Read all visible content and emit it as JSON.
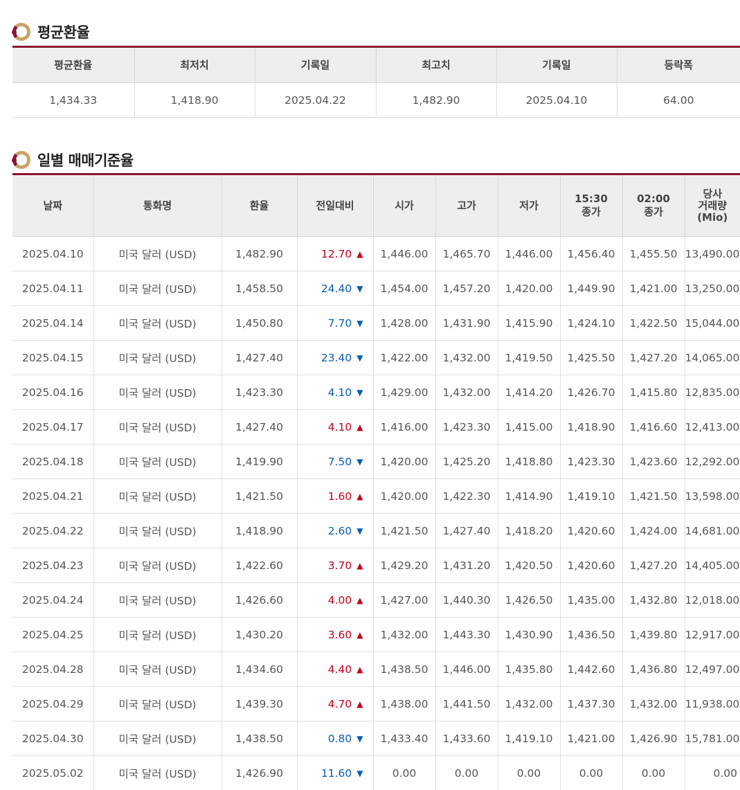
{
  "avg_section": {
    "title": "평균환율",
    "headers": [
      "평균환율",
      "최저치",
      "기록일",
      "최고치",
      "기록일",
      "등락폭"
    ],
    "values": [
      "1,434.33",
      "1,418.90",
      "2025.04.22",
      "1,482.90",
      "2025.04.10",
      "64.00"
    ]
  },
  "daily_section": {
    "title": "일별 매매기준율",
    "headers": [
      "날짜",
      "통화명",
      "환율",
      "전일대비",
      "시가",
      "고가",
      "저가",
      "15:30\n종가",
      "02:00\n종가",
      "당사\n거래량\n(Mio)"
    ],
    "rows": [
      {
        "date": "2025.04.10",
        "currency": "미국 달러 (USD)",
        "rate": "1,482.90",
        "change": "12.70",
        "dir": "up",
        "open": "1,446.00",
        "high": "1,465.70",
        "low": "1,446.00",
        "close1530": "1,456.40",
        "close0200": "1,455.50",
        "volume": "13,490.00"
      },
      {
        "date": "2025.04.11",
        "currency": "미국 달러 (USD)",
        "rate": "1,458.50",
        "change": "24.40",
        "dir": "down",
        "open": "1,454.00",
        "high": "1,457.20",
        "low": "1,420.00",
        "close1530": "1,449.90",
        "close0200": "1,421.00",
        "volume": "13,250.00"
      },
      {
        "date": "2025.04.14",
        "currency": "미국 달러 (USD)",
        "rate": "1,450.80",
        "change": "7.70",
        "dir": "down",
        "open": "1,428.00",
        "high": "1,431.90",
        "low": "1,415.90",
        "close1530": "1,424.10",
        "close0200": "1,422.50",
        "volume": "15,044.00"
      },
      {
        "date": "2025.04.15",
        "currency": "미국 달러 (USD)",
        "rate": "1,427.40",
        "change": "23.40",
        "dir": "down",
        "open": "1,422.00",
        "high": "1,432.00",
        "low": "1,419.50",
        "close1530": "1,425.50",
        "close0200": "1,427.20",
        "volume": "14,065.00"
      },
      {
        "date": "2025.04.16",
        "currency": "미국 달러 (USD)",
        "rate": "1,423.30",
        "change": "4.10",
        "dir": "down",
        "open": "1,429.00",
        "high": "1,432.00",
        "low": "1,414.20",
        "close1530": "1,426.70",
        "close0200": "1,415.80",
        "volume": "12,835.00"
      },
      {
        "date": "2025.04.17",
        "currency": "미국 달러 (USD)",
        "rate": "1,427.40",
        "change": "4.10",
        "dir": "up",
        "open": "1,416.00",
        "high": "1,423.30",
        "low": "1,415.00",
        "close1530": "1,418.90",
        "close0200": "1,416.60",
        "volume": "12,413.00"
      },
      {
        "date": "2025.04.18",
        "currency": "미국 달러 (USD)",
        "rate": "1,419.90",
        "change": "7.50",
        "dir": "down",
        "open": "1,420.00",
        "high": "1,425.20",
        "low": "1,418.80",
        "close1530": "1,423.30",
        "close0200": "1,423.60",
        "volume": "12,292.00"
      },
      {
        "date": "2025.04.21",
        "currency": "미국 달러 (USD)",
        "rate": "1,421.50",
        "change": "1.60",
        "dir": "up",
        "open": "1,420.00",
        "high": "1,422.30",
        "low": "1,414.90",
        "close1530": "1,419.10",
        "close0200": "1,421.50",
        "volume": "13,598.00"
      },
      {
        "date": "2025.04.22",
        "currency": "미국 달러 (USD)",
        "rate": "1,418.90",
        "change": "2.60",
        "dir": "down",
        "open": "1,421.50",
        "high": "1,427.40",
        "low": "1,418.20",
        "close1530": "1,420.60",
        "close0200": "1,424.00",
        "volume": "14,681.00"
      },
      {
        "date": "2025.04.23",
        "currency": "미국 달러 (USD)",
        "rate": "1,422.60",
        "change": "3.70",
        "dir": "up",
        "open": "1,429.20",
        "high": "1,431.20",
        "low": "1,420.50",
        "close1530": "1,420.60",
        "close0200": "1,427.20",
        "volume": "14,405.00"
      },
      {
        "date": "2025.04.24",
        "currency": "미국 달러 (USD)",
        "rate": "1,426.60",
        "change": "4.00",
        "dir": "up",
        "open": "1,427.00",
        "high": "1,440.30",
        "low": "1,426.50",
        "close1530": "1,435.00",
        "close0200": "1,432.80",
        "volume": "12,018.00"
      },
      {
        "date": "2025.04.25",
        "currency": "미국 달러 (USD)",
        "rate": "1,430.20",
        "change": "3.60",
        "dir": "up",
        "open": "1,432.00",
        "high": "1,443.30",
        "low": "1,430.90",
        "close1530": "1,436.50",
        "close0200": "1,439.80",
        "volume": "12,917.00"
      },
      {
        "date": "2025.04.28",
        "currency": "미국 달러 (USD)",
        "rate": "1,434.60",
        "change": "4.40",
        "dir": "up",
        "open": "1,438.50",
        "high": "1,446.00",
        "low": "1,435.80",
        "close1530": "1,442.60",
        "close0200": "1,436.80",
        "volume": "12,497.00"
      },
      {
        "date": "2025.04.29",
        "currency": "미국 달러 (USD)",
        "rate": "1,439.30",
        "change": "4.70",
        "dir": "up",
        "open": "1,438.00",
        "high": "1,441.50",
        "low": "1,432.00",
        "close1530": "1,437.30",
        "close0200": "1,432.00",
        "volume": "11,938.00"
      },
      {
        "date": "2025.04.30",
        "currency": "미국 달러 (USD)",
        "rate": "1,438.50",
        "change": "0.80",
        "dir": "down",
        "open": "1,433.40",
        "high": "1,433.60",
        "low": "1,419.10",
        "close1530": "1,421.00",
        "close0200": "1,426.90",
        "volume": "15,781.00"
      },
      {
        "date": "2025.05.02",
        "currency": "미국 달러 (USD)",
        "rate": "1,426.90",
        "change": "11.60",
        "dir": "down",
        "open": "0.00",
        "high": "0.00",
        "low": "0.00",
        "close1530": "0.00",
        "close0200": "0.00",
        "volume": "0.00"
      }
    ]
  },
  "colors": {
    "up": "#c4001d",
    "down": "#0a5db3",
    "accent": "#8b1330"
  },
  "icons": {
    "section": "ring-bullet-icon",
    "up": "triangle-up-icon",
    "down": "triangle-down-icon"
  }
}
